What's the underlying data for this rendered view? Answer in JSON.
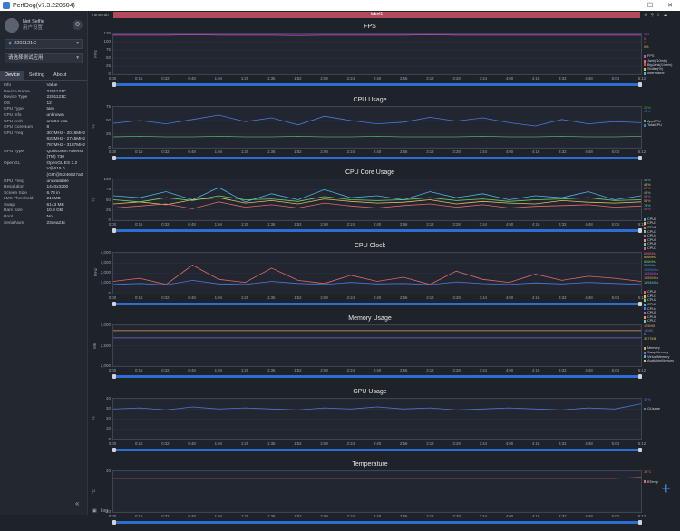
{
  "window": {
    "title": "PerfDog(v7.3.220504)",
    "min": "—",
    "max": "☐",
    "close": "✕"
  },
  "user": {
    "name": "Net Selfie",
    "sub": "用户设置"
  },
  "device_select": "2201121C",
  "app_select": "请选择测试应用",
  "tabs": [
    "Device",
    "Setting",
    "About"
  ],
  "info": {
    "header": [
      "Info",
      "Value"
    ],
    "rows": [
      [
        "Device Name",
        "2201121C"
      ],
      [
        "Device Type",
        "2201121C"
      ],
      [
        "OS",
        "12"
      ],
      [
        "CPU Type",
        "taro"
      ],
      [
        "CPU Info",
        "unknown"
      ],
      [
        "CPU Arch",
        "arm64-v8a"
      ],
      [
        "CPU CoreNum",
        "8"
      ],
      [
        "CPU Freq",
        "307MHz - 2016MHz\n633MHz - 2745MHz\n787MHz - 3187MHz"
      ],
      [
        "GPU Type",
        "Qualcomm Adreno\n(TM) 730"
      ],
      [
        "OpenGL",
        "OpenGL ES 3.2\nV@615.0\n(GIT@5f246827a0"
      ],
      [
        "GPU Freq",
        "unavailable"
      ],
      [
        "Resolution",
        "1440x3200"
      ],
      [
        "Screen Size",
        "6.73 in"
      ],
      [
        "LMK Threshold",
        "216MB"
      ],
      [
        "Swap",
        "6143 MB"
      ],
      [
        "Ram Size",
        "10.9 GB"
      ],
      [
        "Root",
        "No"
      ],
      [
        "SerialNum",
        "23cea21c"
      ]
    ]
  },
  "topbar": {
    "frametab": "frameTab",
    "label": "label1"
  },
  "x_ticks": [
    "0:00",
    "0:16",
    "0:32",
    "0:48",
    "1:04",
    "1:20",
    "1:36",
    "1:52",
    "2:08",
    "2:24",
    "2:40",
    "2:56",
    "3:12",
    "3:28",
    "3:44",
    "4:00",
    "4:16",
    "4:32",
    "4:48",
    "5:04",
    "5:12"
  ],
  "colors": {
    "accent": "#2b6fd6",
    "label_bar": "#b24c5d"
  },
  "log_label": "Log",
  "charts": [
    {
      "title": "FPS",
      "unit": "FPS",
      "yticks": [
        "125",
        "100",
        "75",
        "50",
        "25",
        "0"
      ],
      "ymax": 125,
      "series": [
        {
          "name": "FPS",
          "color": "#c04fd0",
          "values": [
            120,
            120,
            120,
            121,
            120,
            120,
            120,
            119,
            120,
            120,
            120,
            120,
            121,
            120,
            120,
            120,
            120,
            120,
            120,
            120,
            120
          ]
        }
      ],
      "legend": [
        [
          "FPS",
          "#c04fd0"
        ],
        [
          "Jank(/10min)",
          "#e26a6a"
        ],
        [
          "BigJank(/10min)",
          "#e04545"
        ],
        [
          "Stutter(%)",
          "#e2c15a"
        ],
        [
          "InterFrame",
          "#4bb6e2"
        ]
      ],
      "vals": [
        "120",
        "0",
        "0",
        "0%"
      ]
    },
    {
      "title": "CPU Usage",
      "unit": "%",
      "yticks": [
        "75",
        "50",
        "25",
        "0"
      ],
      "ymax": 75,
      "series": [
        {
          "name": "AppCPU",
          "color": "#4fae5b",
          "values": [
            20,
            21,
            20,
            20,
            21,
            20,
            20,
            21,
            20,
            20,
            21,
            20,
            20,
            20,
            21,
            20,
            20,
            21,
            20,
            20,
            21
          ]
        },
        {
          "name": "TotalCPU",
          "color": "#4b79d8",
          "values": [
            45,
            50,
            44,
            52,
            60,
            48,
            55,
            42,
            58,
            50,
            44,
            47,
            56,
            49,
            55,
            46,
            40,
            52,
            44,
            48,
            46
          ]
        }
      ],
      "legend": [
        [
          "AppCPU",
          "#4fae5b"
        ],
        [
          "TotalCPU",
          "#4b79d8"
        ]
      ],
      "vals": [
        "20%",
        "45%"
      ]
    },
    {
      "title": "CPU Core Usage",
      "unit": "%",
      "yticks": [
        "100",
        "75",
        "50",
        "25",
        "0"
      ],
      "ymax": 100,
      "series": [
        {
          "name": "CPU0",
          "color": "#4bb6e2",
          "values": [
            60,
            55,
            70,
            50,
            80,
            45,
            65,
            50,
            75,
            55,
            60,
            50,
            70,
            55,
            65,
            50,
            60,
            55,
            70,
            50,
            60
          ]
        },
        {
          "name": "CPU1",
          "color": "#e2c15a",
          "values": [
            40,
            45,
            38,
            50,
            55,
            42,
            48,
            40,
            52,
            46,
            42,
            44,
            50,
            40,
            46,
            42,
            40,
            48,
            44,
            42,
            45
          ]
        },
        {
          "name": "CPU2",
          "color": "#e26a6a",
          "values": [
            30,
            35,
            40,
            28,
            45,
            32,
            38,
            30,
            42,
            35,
            30,
            36,
            40,
            32,
            38,
            30,
            34,
            36,
            38,
            32,
            35
          ]
        },
        {
          "name": "CPU3",
          "color": "#7bd06f",
          "values": [
            50,
            45,
            55,
            48,
            60,
            50,
            52,
            46,
            58,
            50,
            48,
            50,
            55,
            48,
            52,
            46,
            50,
            52,
            55,
            48,
            50
          ]
        }
      ],
      "legend": [
        [
          "CPU0",
          "#4bb6e2"
        ],
        [
          "CPU1",
          "#e2c15a"
        ],
        [
          "CPU2",
          "#e26a6a"
        ],
        [
          "CPU3",
          "#7bd06f"
        ],
        [
          "CPU4",
          "#c04fd0"
        ],
        [
          "CPU5",
          "#e2a05a"
        ],
        [
          "CPU6",
          "#5ad0c4"
        ],
        [
          "CPU7",
          "#d05a8a"
        ]
      ],
      "vals": [
        "45%",
        "48%",
        "27%",
        "43%",
        "53%",
        "55%",
        "78%",
        "45%"
      ]
    },
    {
      "title": "CPU Clock",
      "unit": "MHz",
      "yticks": [
        "4,000",
        "3,000",
        "2,000",
        "1,000",
        "0"
      ],
      "ymax": 4000,
      "series": [
        {
          "name": "CPU0",
          "color": "#e26a6a",
          "values": [
            1200,
            1500,
            900,
            2800,
            1400,
            1100,
            2500,
            1300,
            1000,
            1800,
            1200,
            1600,
            900,
            2200,
            1400,
            1100,
            1900,
            1300,
            1700,
            1500,
            1200
          ]
        },
        {
          "name": "CPU4",
          "color": "#4b79d8",
          "values": [
            900,
            1000,
            850,
            1300,
            950,
            900,
            1200,
            1000,
            900,
            1100,
            950,
            1000,
            880,
            1150,
            980,
            900,
            1050,
            950,
            1100,
            1000,
            900
          ]
        }
      ],
      "legend": [
        [
          "CPU0",
          "#e26a6a"
        ],
        [
          "CPU1",
          "#e2c15a"
        ],
        [
          "CPU2",
          "#7bd06f"
        ],
        [
          "CPU3",
          "#4bb6e2"
        ],
        [
          "CPU4",
          "#4b79d8"
        ],
        [
          "CPU5",
          "#c04fd0"
        ],
        [
          "CPU6",
          "#e2a05a"
        ],
        [
          "CPU7",
          "#5ad0c4"
        ]
      ],
      "vals": [
        "806MHz",
        "806MHz",
        "806MHz",
        "806MHz",
        "1555MHz",
        "1555MHz",
        "1555MHz",
        "1594MHz"
      ]
    },
    {
      "title": "Memory Usage",
      "unit": "MB",
      "yticks": [
        "3,000",
        "2,500",
        "2,000"
      ],
      "ymax": 3000,
      "series": [
        {
          "name": "Memory",
          "color": "#e2a05a",
          "values": [
            2610,
            2610,
            2610,
            2610,
            2610,
            2610,
            2610,
            2610,
            2610,
            2610,
            2610,
            2610,
            2610,
            2610,
            2610,
            2610,
            2610,
            2610,
            2610,
            2610,
            2610
          ]
        },
        {
          "name": "SwapMemory",
          "color": "#7b6fd0",
          "values": [
            2075,
            2075,
            2075,
            2075,
            2075,
            2075,
            2075,
            2075,
            2075,
            2075,
            2075,
            2075,
            2075,
            2075,
            2075,
            2075,
            2075,
            2075,
            2075,
            2075,
            2075
          ]
        }
      ],
      "legend": [
        [
          "Memory",
          "#e2a05a"
        ],
        [
          "SwapMemory",
          "#7b6fd0"
        ],
        [
          "VirtualMemory",
          "#4bb6e2"
        ],
        [
          "AvailableMemory",
          "#e2c15a"
        ]
      ],
      "vals": [
        "125MB",
        "14MB",
        "6",
        "3277MB"
      ]
    },
    {
      "title": "GPU Usage",
      "unit": "%",
      "yticks": [
        "40",
        "30",
        "20",
        "10",
        "0"
      ],
      "ymax": 40,
      "series": [
        {
          "name": "GUsage",
          "color": "#4b79d8",
          "values": [
            30,
            31,
            29,
            32,
            30,
            31,
            30,
            29,
            31,
            30,
            32,
            30,
            31,
            29,
            30,
            31,
            30,
            29,
            31,
            30,
            35
          ]
        }
      ],
      "legend": [
        [
          "GUsage",
          "#4b79d8"
        ]
      ],
      "vals": [
        "30%"
      ]
    },
    {
      "title": "Temperature",
      "unit": "°C",
      "yticks": [
        "40",
        "20"
      ],
      "ymax": 40,
      "series": [
        {
          "name": "BTemp",
          "color": "#e26a6a",
          "values": [
            33,
            33,
            33,
            33,
            33,
            33,
            33,
            33,
            33,
            33,
            33,
            33,
            33,
            33,
            33,
            33,
            33,
            33,
            33,
            33,
            34
          ]
        }
      ],
      "legend": [
        [
          "BTemp",
          "#e26a6a"
        ]
      ],
      "vals": [
        "33°C"
      ]
    }
  ]
}
